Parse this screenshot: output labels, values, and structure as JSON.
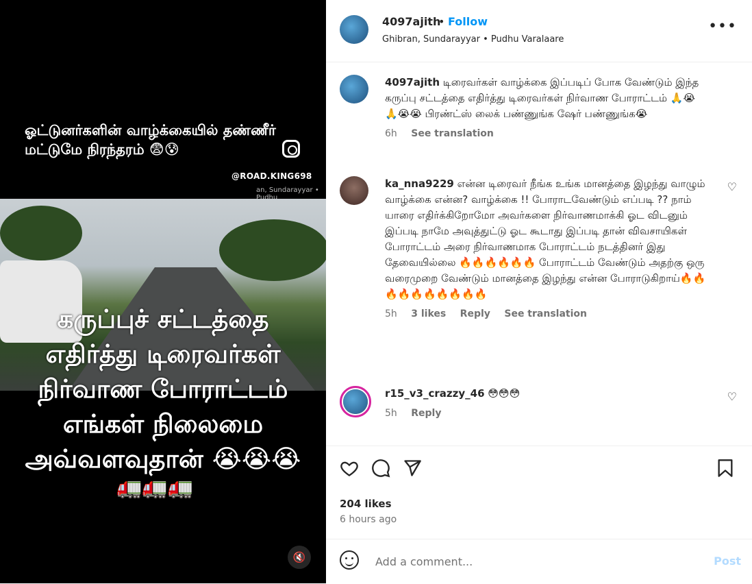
{
  "media": {
    "overlay_top": "ஓட்டுனர்களின் வாழ்க்கையில் தண்ணீர் மட்டுமே நிரந்தரம் 😨😰",
    "handle": "@ROAD.KING698",
    "small_location": "an, Sundarayyar • Pudhu",
    "big_text_1": "கருப்புச் சட்டத்தை",
    "big_text_2": "எதிர்த்து டிரைவர்கள்",
    "big_text_3": "நிர்வாண போராட்டம்",
    "big_text_4": "எங்கள் நிலைமை",
    "big_text_5": "அவ்வளவுதான் 😭😭😭",
    "trucks": "🚛🚛🚛",
    "mute_icon": "speaker-muted-icon"
  },
  "header": {
    "username": "4097ajith",
    "dot": "•",
    "follow_label": "Follow",
    "audio": "Ghibran, Sundarayyar • Pudhu Varalaare",
    "more_label": "•••"
  },
  "caption": {
    "username": "4097ajith",
    "text": "டிரைவர்கள் வாழ்க்கை இப்படிப் போக வேண்டும் இந்த கருப்பு சட்டத்தை எதிர்த்து டிரைவர்கள் நிர்வாண போராட்டம் 🙏😭🙏😭😭 பிரண்ட்ஸ் லைக் பண்ணுங்க ஷேர் பண்ணுங்க😭",
    "time": "6h",
    "see_translation": "See translation"
  },
  "comments": [
    {
      "username": "ka_nna9229",
      "text": "என்ன டிரைவர் நீங்க உங்க மானத்தை இழந்து வாழும் வாழ்க்கை என்ன? வாழ்க்கை !! போராடவேண்டும் எப்படி ?? நாம் யாரை எதிர்க்கிறோமோ அவர்களை நிர்வாணமாக்கி ஓட விடனும் இப்படி நாமே அவுத்துட்டு ஓட கூடாது இப்படி தான் விவசாயிகள் போராட்டம் அரை நிர்வாணமாக போராட்டம் நடத்தினர் இது தேவையில்லை 🔥🔥🔥🔥🔥🔥 போராட்டம் வேண்டும் அதற்கு ஒரு வரைமுறை வேண்டும் மானத்தை இழந்து என்ன போராடுகிறாய்🔥🔥🔥🔥🔥🔥🔥🔥🔥🔥",
      "time": "5h",
      "likes": "3 likes",
      "reply": "Reply",
      "see_translation": "See translation"
    },
    {
      "username": "r15_v3_crazzy_46",
      "text": "😳😳😳",
      "time": "5h",
      "reply": "Reply"
    }
  ],
  "actions": {
    "like_icon": "heart-icon",
    "comment_icon": "comment-icon",
    "share_icon": "share-icon",
    "save_icon": "bookmark-icon"
  },
  "stats": {
    "likes": "204 likes",
    "ago": "6 hours ago"
  },
  "add_comment": {
    "placeholder": "Add a comment...",
    "post_label": "Post"
  }
}
